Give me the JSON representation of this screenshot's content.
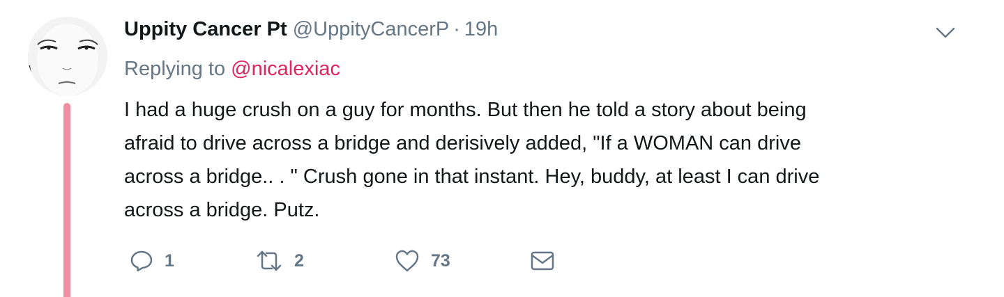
{
  "tweet": {
    "display_name": "Uppity Cancer Pt",
    "handle": "@UppityCancerP",
    "separator": "·",
    "time": "19h",
    "reply_prefix": "Replying to ",
    "reply_to": "@nicalexiac",
    "text": "I had a huge crush on a guy for months. But then he told a story about being\nafraid to drive across a bridge and derisively added, \"If a WOMAN can drive\nacross a bridge.. . \" Crush gone in that instant. Hey, buddy, at least I can drive\nacross a bridge.  Putz."
  },
  "actions": {
    "reply_count": "1",
    "retweet_count": "2",
    "like_count": "73"
  },
  "icons": {
    "avatar": "avatar-face-drawing",
    "caret": "chevron-down-icon",
    "reply": "reply-icon",
    "retweet": "retweet-icon",
    "like": "heart-icon",
    "message": "envelope-icon"
  },
  "colors": {
    "mention": "#e0245e",
    "thread_line": "#f08da0",
    "secondary_text": "#657786",
    "primary_text": "#14171a"
  }
}
